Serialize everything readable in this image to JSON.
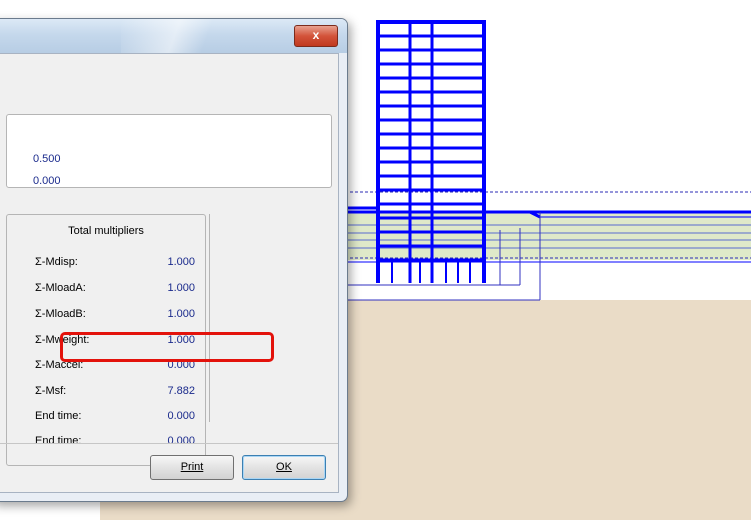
{
  "window": {
    "close_label": "x"
  },
  "values": [
    "0.500",
    "0.000"
  ],
  "multipliers": {
    "header": "Total multipliers",
    "rows": [
      {
        "label": "Σ-Mdisp:",
        "value": "1.000"
      },
      {
        "label": "Σ-MloadA:",
        "value": "1.000"
      },
      {
        "label": "Σ-MloadB:",
        "value": "1.000"
      },
      {
        "label": "Σ-Mweight:",
        "value": "1.000"
      },
      {
        "label": "Σ-Maccel:",
        "value": "0.000"
      },
      {
        "label": "Σ-Msf:",
        "value": "7.882"
      },
      {
        "label": "End time:",
        "value": "0.000"
      },
      {
        "label": "End time:",
        "value": "0.000"
      }
    ]
  },
  "buttons": {
    "print": "Print",
    "ok": "OK"
  },
  "colors": {
    "structure": "#0000ff",
    "soil": "#eadcc7",
    "soil_layer": "#dfe9c9",
    "highlight": "#e3120b",
    "value_text": "#1a2a8c"
  }
}
